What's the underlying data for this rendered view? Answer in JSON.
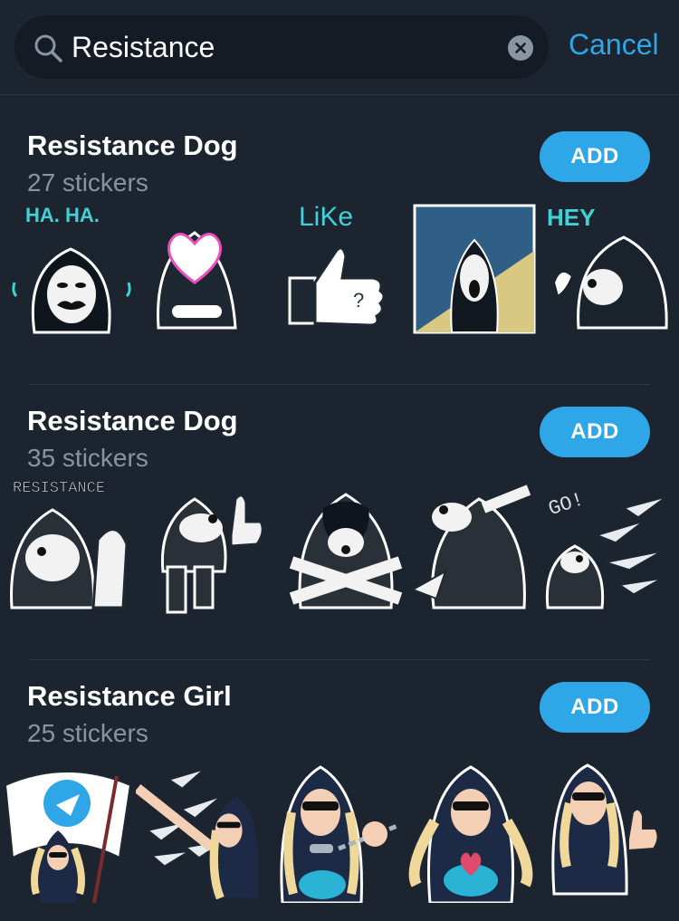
{
  "search": {
    "query": "Resistance",
    "cancel_label": "Cancel"
  },
  "packs": [
    {
      "title": "Resistance Dog",
      "count": "27 stickers",
      "add_label": "ADD",
      "stickers": [
        {
          "name": "hooded-mask-dog-sticker",
          "caption": "HA. HA."
        },
        {
          "name": "heart-hood-sticker",
          "caption": ""
        },
        {
          "name": "thumbs-up-like-sticker",
          "caption": "LiKe"
        },
        {
          "name": "scream-painting-sticker",
          "caption": ""
        },
        {
          "name": "hey-dog-sticker",
          "caption": "HEY"
        }
      ]
    },
    {
      "title": "Resistance Dog",
      "count": "35 stickers",
      "add_label": "ADD",
      "stickers": [
        {
          "name": "strong-arm-dog-sticker",
          "caption": "RESISTANCE"
        },
        {
          "name": "thumbs-up-dog-sticker",
          "caption": ""
        },
        {
          "name": "crossed-arms-dog-sticker",
          "caption": ""
        },
        {
          "name": "dab-dog-sticker",
          "caption": ""
        },
        {
          "name": "go-planes-dog-sticker",
          "caption": "GO!"
        }
      ]
    },
    {
      "title": "Resistance Girl",
      "count": "25 stickers",
      "add_label": "ADD",
      "stickers": [
        {
          "name": "flag-girl-sticker",
          "caption": ""
        },
        {
          "name": "throwing-planes-girl-sticker",
          "caption": ""
        },
        {
          "name": "broken-chains-girl-sticker",
          "caption": ""
        },
        {
          "name": "heart-girl-sticker",
          "caption": ""
        },
        {
          "name": "thumbs-up-girl-sticker",
          "caption": ""
        }
      ]
    }
  ]
}
